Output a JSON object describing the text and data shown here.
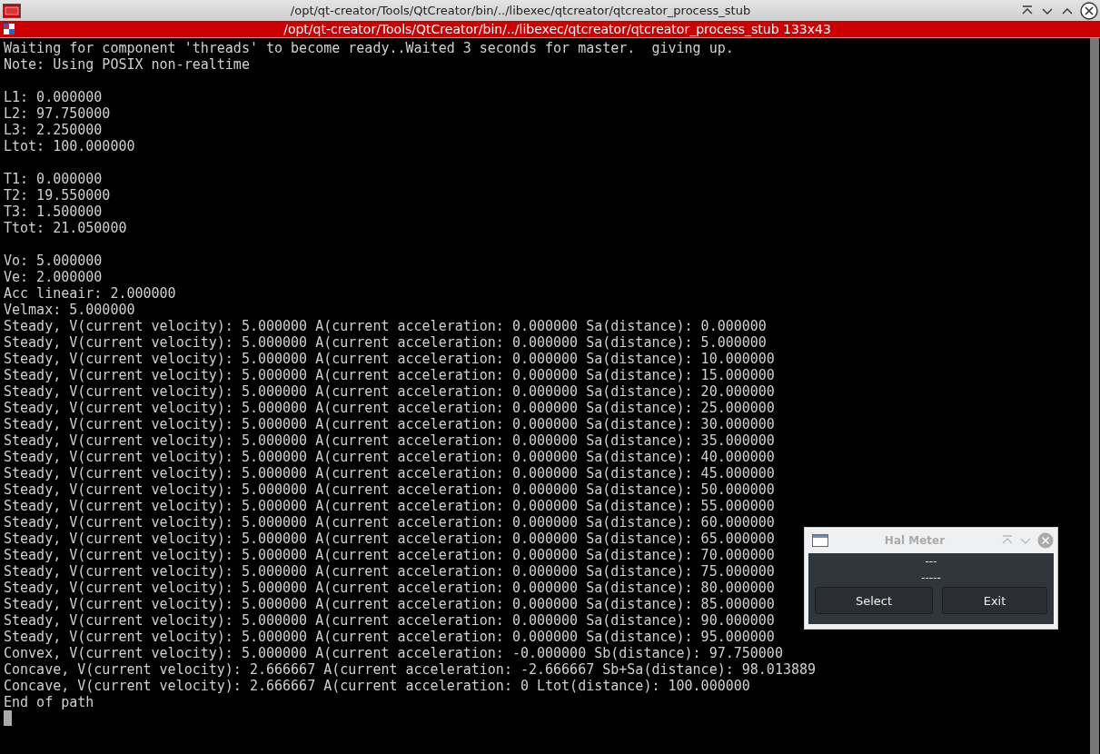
{
  "window": {
    "title": "/opt/qt-creator/Tools/QtCreator/bin/../libexec/qtcreator/qtcreator_process_stub"
  },
  "terminal": {
    "title": "/opt/qt-creator/Tools/QtCreator/bin/../libexec/qtcreator/qtcreator_process_stub 133x43",
    "blocks": [
      [
        "Waiting for component 'threads' to become ready..Waited 3 seconds for master.  giving up.",
        "Note: Using POSIX non-realtime"
      ],
      [
        "L1: 0.000000",
        "L2: 97.750000",
        "L3: 2.250000",
        "Ltot: 100.000000"
      ],
      [
        "T1: 0.000000",
        "T2: 19.550000",
        "T3: 1.500000",
        "Ttot: 21.050000"
      ],
      [
        "Vo: 5.000000",
        "Ve: 2.000000",
        "Acc lineair: 2.000000",
        "Velmax: 5.000000",
        "Steady, V(current velocity): 5.000000 A(current acceleration: 0.000000 Sa(distance): 0.000000",
        "Steady, V(current velocity): 5.000000 A(current acceleration: 0.000000 Sa(distance): 5.000000",
        "Steady, V(current velocity): 5.000000 A(current acceleration: 0.000000 Sa(distance): 10.000000",
        "Steady, V(current velocity): 5.000000 A(current acceleration: 0.000000 Sa(distance): 15.000000",
        "Steady, V(current velocity): 5.000000 A(current acceleration: 0.000000 Sa(distance): 20.000000",
        "Steady, V(current velocity): 5.000000 A(current acceleration: 0.000000 Sa(distance): 25.000000",
        "Steady, V(current velocity): 5.000000 A(current acceleration: 0.000000 Sa(distance): 30.000000",
        "Steady, V(current velocity): 5.000000 A(current acceleration: 0.000000 Sa(distance): 35.000000",
        "Steady, V(current velocity): 5.000000 A(current acceleration: 0.000000 Sa(distance): 40.000000",
        "Steady, V(current velocity): 5.000000 A(current acceleration: 0.000000 Sa(distance): 45.000000",
        "Steady, V(current velocity): 5.000000 A(current acceleration: 0.000000 Sa(distance): 50.000000",
        "Steady, V(current velocity): 5.000000 A(current acceleration: 0.000000 Sa(distance): 55.000000",
        "Steady, V(current velocity): 5.000000 A(current acceleration: 0.000000 Sa(distance): 60.000000",
        "Steady, V(current velocity): 5.000000 A(current acceleration: 0.000000 Sa(distance): 65.000000",
        "Steady, V(current velocity): 5.000000 A(current acceleration: 0.000000 Sa(distance): 70.000000",
        "Steady, V(current velocity): 5.000000 A(current acceleration: 0.000000 Sa(distance): 75.000000",
        "Steady, V(current velocity): 5.000000 A(current acceleration: 0.000000 Sa(distance): 80.000000",
        "Steady, V(current velocity): 5.000000 A(current acceleration: 0.000000 Sa(distance): 85.000000",
        "Steady, V(current velocity): 5.000000 A(current acceleration: 0.000000 Sa(distance): 90.000000",
        "Steady, V(current velocity): 5.000000 A(current acceleration: 0.000000 Sa(distance): 95.000000",
        "Convex, V(current velocity): 5.000000 A(current acceleration: -0.000000 Sb(distance): 97.750000",
        "Concave, V(current velocity): 2.666667 A(current acceleration: -2.666667 Sb+Sa(distance): 98.013889",
        "Concave, V(current velocity): 2.666667 A(current acceleration: 0 Ltot(distance): 100.000000",
        "End of path"
      ]
    ]
  },
  "hal_meter": {
    "title": "Hal Meter",
    "value": "---",
    "name": "-----",
    "buttons": [
      "Select",
      "Exit"
    ]
  }
}
